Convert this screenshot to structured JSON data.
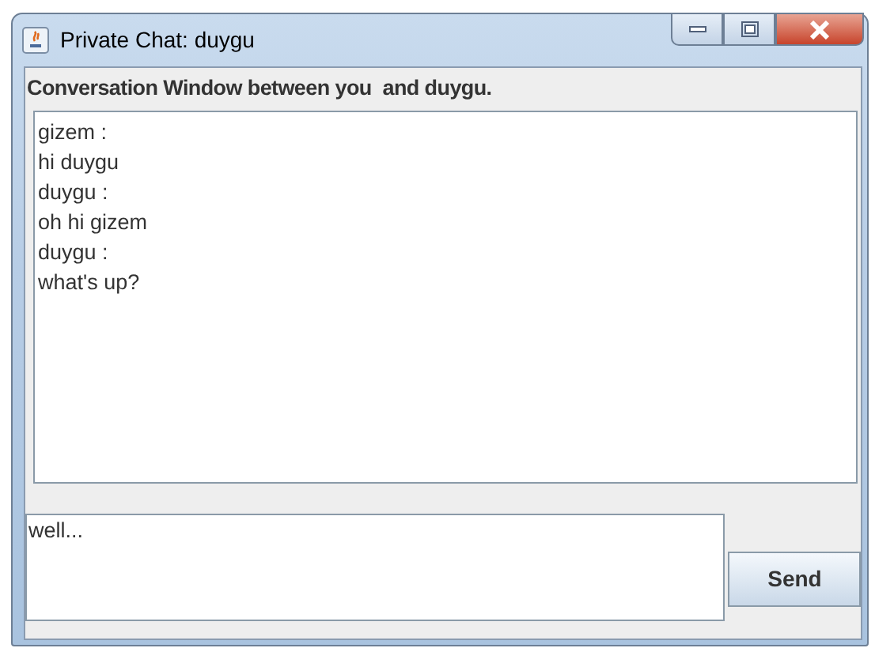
{
  "window": {
    "title": "Private Chat: duygu"
  },
  "heading": "Conversation Window between you  and duygu.",
  "conversation": [
    "gizem :",
    "hi duygu",
    "duygu :",
    "oh hi gizem",
    "duygu :",
    "what's up?"
  ],
  "message_input": {
    "value": "well..."
  },
  "buttons": [
    "Send"
  ]
}
